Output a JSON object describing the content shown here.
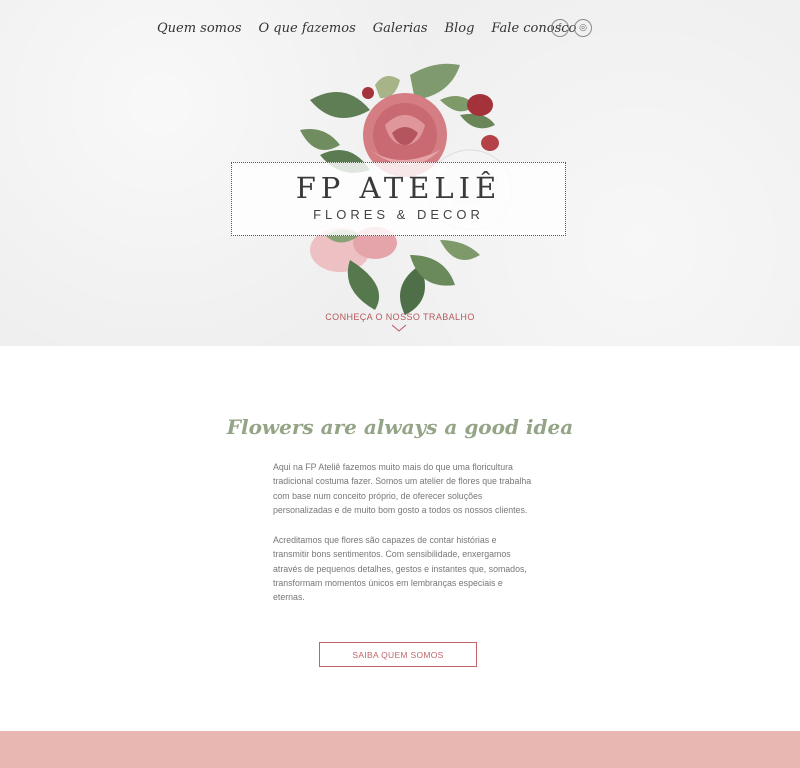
{
  "nav": {
    "items": [
      "Quem somos",
      "O que fazemos",
      "Galerias",
      "Blog",
      "Fale conosco"
    ]
  },
  "social": {
    "facebook_icon": "facebook-icon",
    "instagram_icon": "instagram-icon",
    "facebook_glyph": "f",
    "instagram_glyph": "◎"
  },
  "logo": {
    "title": "FP ATELIÊ",
    "subtitle": "FLORES & DECOR"
  },
  "hero": {
    "cta": "CONHEÇA O NOSSO TRABALHO"
  },
  "about": {
    "title": "Flowers are always a good idea",
    "paragraph1": "Aqui na FP Ateliê fazemos muito mais do que uma floricultura tradicional costuma fazer. Somos um atelier de flores que trabalha com base num conceito próprio, de oferecer soluções personalizadas e de muito bom gosto a todos os nossos clientes.",
    "paragraph2": "Acreditamos que flores são capazes de contar histórias e transmitir bons sentimentos. Com sensibilidade, enxergamos através de pequenos detalhes, gestos e instantes que, somados, transformam momentos únicos em lembranças especiais e eternas.",
    "button": "SAIBA QUEM SOMOS"
  },
  "colors": {
    "accent": "#c0666a",
    "title_green": "#94a487",
    "footer_band": "#e8b7b2",
    "hero_bg": "#efefef"
  }
}
